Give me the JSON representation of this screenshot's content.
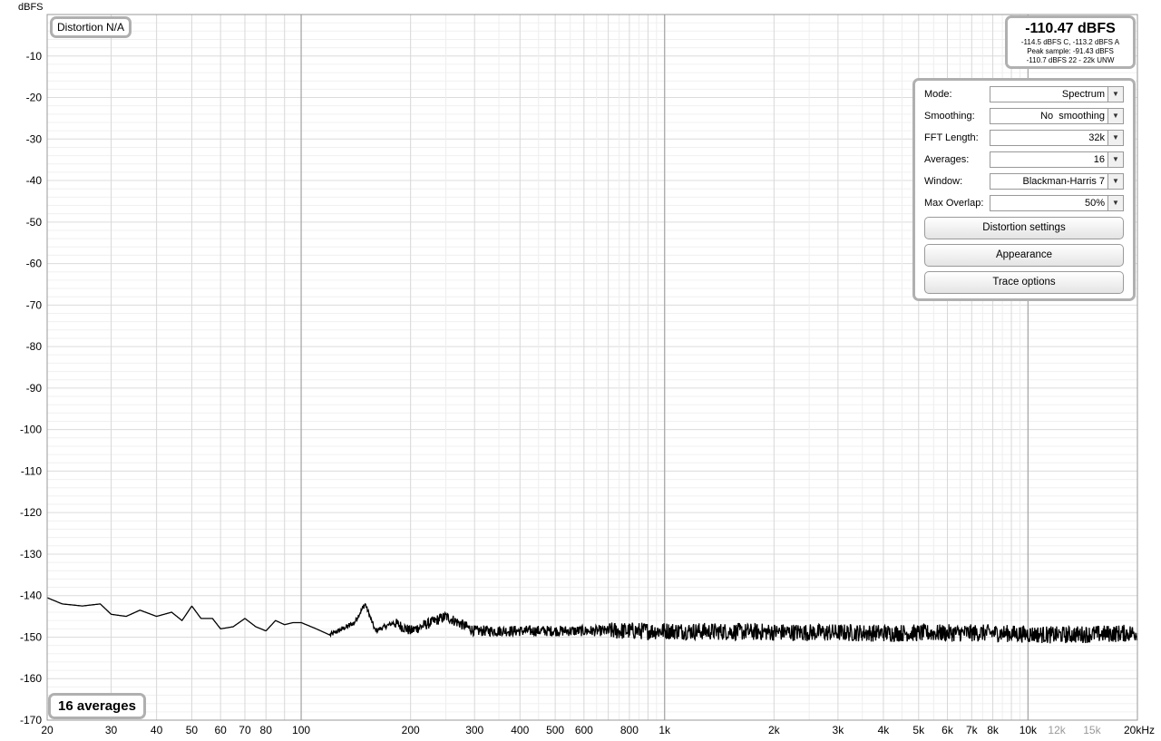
{
  "chart_data": {
    "type": "line",
    "ylabel": "dBFS",
    "xscale": "log",
    "xlim": [
      20,
      20000
    ],
    "ylim": [
      -170,
      0
    ],
    "grid": true,
    "y_ticks": [
      "-10",
      "-20",
      "-30",
      "-40",
      "-50",
      "-60",
      "-70",
      "-80",
      "-90",
      "-100",
      "-110",
      "-120",
      "-130",
      "-140",
      "-150",
      "-160",
      "-170"
    ],
    "x_ticks": [
      {
        "v": 20,
        "t": "20"
      },
      {
        "v": 30,
        "t": "30"
      },
      {
        "v": 40,
        "t": "40"
      },
      {
        "v": 50,
        "t": "50"
      },
      {
        "v": 60,
        "t": "60"
      },
      {
        "v": 70,
        "t": "70"
      },
      {
        "v": 80,
        "t": "80"
      },
      {
        "v": 100,
        "t": "100"
      },
      {
        "v": 200,
        "t": "200"
      },
      {
        "v": 300,
        "t": "300"
      },
      {
        "v": 400,
        "t": "400"
      },
      {
        "v": 500,
        "t": "500"
      },
      {
        "v": 600,
        "t": "600"
      },
      {
        "v": 800,
        "t": "800"
      },
      {
        "v": 1000,
        "t": "1k"
      },
      {
        "v": 2000,
        "t": "2k"
      },
      {
        "v": 3000,
        "t": "3k"
      },
      {
        "v": 4000,
        "t": "4k"
      },
      {
        "v": 5000,
        "t": "5k"
      },
      {
        "v": 6000,
        "t": "6k"
      },
      {
        "v": 7000,
        "t": "7k"
      },
      {
        "v": 8000,
        "t": "8k"
      },
      {
        "v": 10000,
        "t": "10k"
      },
      {
        "v": 12000,
        "t": "12k",
        "muted": true
      },
      {
        "v": 15000,
        "t": "15k",
        "muted": true
      },
      {
        "v": 20000,
        "t": "20kHz"
      }
    ],
    "series": [
      {
        "color": "#000000",
        "x": [
          20,
          22,
          25,
          28,
          30,
          33,
          36,
          40,
          44,
          47,
          50,
          53,
          57,
          60,
          65,
          70,
          75,
          80,
          85,
          90,
          95,
          100,
          110,
          120,
          130,
          140,
          150,
          160,
          180,
          200,
          250,
          300,
          400,
          500,
          700,
          1000,
          2000,
          4000,
          5000,
          8000,
          12000,
          20000
        ],
        "y": [
          -140.5,
          -142,
          -142.5,
          -142,
          -144.5,
          -145,
          -143.5,
          -145,
          -144,
          -146,
          -142.5,
          -145.5,
          -145.5,
          -148,
          -147.5,
          -145.5,
          -147.5,
          -148.5,
          -146,
          -147,
          -146.5,
          -146.5,
          -148,
          -149.5,
          -148,
          -146.5,
          -142,
          -148.5,
          -146.5,
          -148.5,
          -145,
          -148.5,
          -148.5,
          -148.5,
          -148.5,
          -148.5,
          -148.8,
          -149,
          -149,
          -149,
          -149.5,
          -149
        ]
      }
    ]
  },
  "overlays": {
    "distortion": "Distortion N/A",
    "averages": "16 averages"
  },
  "readout": {
    "main": "-110.47 dBFS",
    "line1": "-114.5 dBFS C, -113.2 dBFS A",
    "line2": "Peak sample: -91.43 dBFS",
    "line3": "-110.7 dBFS 22 - 22k UNW"
  },
  "controls": {
    "mode_label": "Mode:",
    "mode_value": "Spectrum",
    "smoothing_label": "Smoothing:",
    "smoothing_value": "No  smoothing",
    "fft_label": "FFT Length:",
    "fft_value": "32k",
    "averages_label": "Averages:",
    "averages_value": "16",
    "window_label": "Window:",
    "window_value": "Blackman-Harris 7",
    "overlap_label": "Max Overlap:",
    "overlap_value": "50%",
    "distortion_settings": "Distortion settings",
    "appearance": "Appearance",
    "trace_options": "Trace options"
  }
}
